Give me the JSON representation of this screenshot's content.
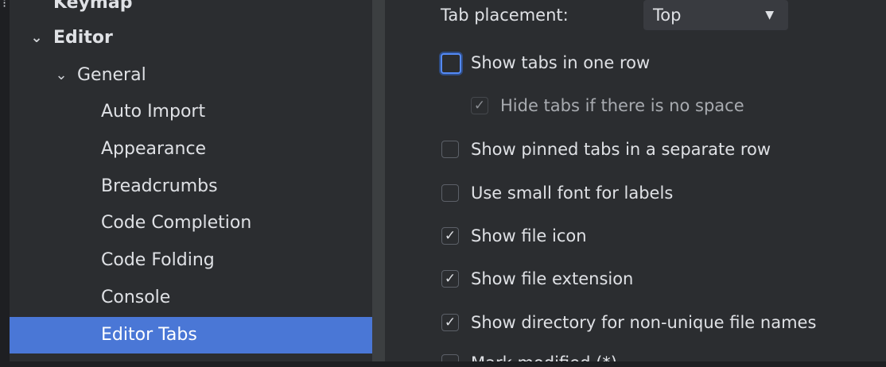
{
  "sidebar": {
    "items": [
      {
        "label": "Keymap",
        "chevron": ""
      },
      {
        "label": "Editor",
        "chevron": "⌄"
      },
      {
        "label": "General",
        "chevron": "⌄"
      },
      {
        "label": "Auto Import",
        "chevron": ""
      },
      {
        "label": "Appearance",
        "chevron": ""
      },
      {
        "label": "Breadcrumbs",
        "chevron": ""
      },
      {
        "label": "Code Completion",
        "chevron": ""
      },
      {
        "label": "Code Folding",
        "chevron": ""
      },
      {
        "label": "Console",
        "chevron": ""
      },
      {
        "label": "Editor Tabs",
        "chevron": ""
      }
    ],
    "selected": "Editor Tabs"
  },
  "settings": {
    "tab_placement": {
      "label": "Tab placement:",
      "value": "Top",
      "arrow_icon": "▼"
    },
    "options": [
      {
        "label": "Show tabs in one row",
        "checked": false
      },
      {
        "label": "Hide tabs if there is no space",
        "checked": true,
        "disabled": true
      },
      {
        "label": "Show pinned tabs in a separate row",
        "checked": false
      },
      {
        "label": "Use small font for labels",
        "checked": false
      },
      {
        "label": "Show file icon",
        "checked": true
      },
      {
        "label": "Show file extension",
        "checked": true
      },
      {
        "label": "Show directory for non-unique file names",
        "checked": true
      },
      {
        "label": "Mark modified (*)",
        "checked": false
      }
    ],
    "check_glyph": "✓"
  },
  "colors": {
    "selection": "#4a77d6",
    "focus": "#548af7",
    "panel": "#2b2d30"
  }
}
